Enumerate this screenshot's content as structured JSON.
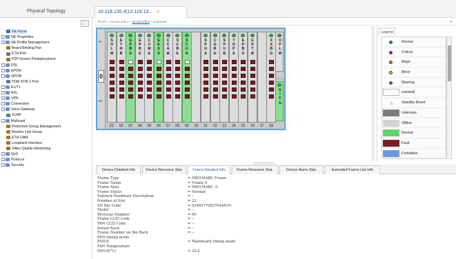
{
  "tabs": {
    "physical_topology": "Physical Topology",
    "active_tab": "10.118.135.4(10.118.13...",
    "close": "×"
  },
  "breadcrumb": {
    "root": "ROOT",
    "ip1": "10.118.135.4",
    "ip2": "10.118.135.4",
    "subrack": "Subrack0",
    "sep": ">"
  },
  "tree": [
    {
      "label": "NE Panel",
      "ctl": "",
      "icon": "ne-panel",
      "selected": true
    },
    {
      "label": "NE Properties",
      "ctl": "+",
      "icon": "folder"
    },
    {
      "label": "NE Profile Management",
      "ctl": "+",
      "icon": "folder"
    },
    {
      "label": "Board Binding Pair",
      "ctl": "",
      "icon": "gear"
    },
    {
      "label": "ETH Port",
      "ctl": "",
      "icon": "port"
    },
    {
      "label": "P2P Device Predeployment",
      "ctl": "",
      "icon": "gear"
    },
    {
      "label": "DSL",
      "ctl": "+",
      "icon": "folder"
    },
    {
      "label": "EPON",
      "ctl": "+",
      "icon": "folder"
    },
    {
      "label": "GPON",
      "ctl": "+",
      "icon": "folder"
    },
    {
      "label": "TDM STM-1 Port",
      "ctl": "",
      "icon": "port"
    },
    {
      "label": "E1/T1",
      "ctl": "+",
      "icon": "folder"
    },
    {
      "label": "ASL",
      "ctl": "+",
      "icon": "folder"
    },
    {
      "label": "VPN",
      "ctl": "+",
      "icon": "folder"
    },
    {
      "label": "Connection",
      "ctl": "+",
      "icon": "folder"
    },
    {
      "label": "Voice Gateway",
      "ctl": "+",
      "icon": "folder"
    },
    {
      "label": "VLAN",
      "ctl": "",
      "icon": "port"
    },
    {
      "label": "Multicast",
      "ctl": "+",
      "icon": "folder"
    },
    {
      "label": "Protection Group Management",
      "ctl": "",
      "icon": "gear"
    },
    {
      "label": "Monitor Link Group",
      "ctl": "",
      "icon": "gear"
    },
    {
      "label": "ETH OAM",
      "ctl": "",
      "icon": "gear"
    },
    {
      "label": "Loopback Interface",
      "ctl": "",
      "icon": "gear"
    },
    {
      "label": "Video Quality Monitoring",
      "ctl": "",
      "icon": "gear"
    },
    {
      "label": "QoS",
      "ctl": "+",
      "icon": "folder"
    },
    {
      "label": "Protocol",
      "ctl": "+",
      "icon": "folder"
    },
    {
      "label": "Security",
      "ctl": "+",
      "icon": "folder"
    }
  ],
  "frame": {
    "row_labels": {
      "top": "21",
      "mid": "0",
      "bottom": "30"
    },
    "right_labels": {
      "r1": "19",
      "r2": "20"
    },
    "slots": [
      {
        "num": "01",
        "label": "S\nH\nL\nM",
        "green": false
      },
      {
        "num": "02",
        "label": "E\nT\nH\nB",
        "green": false
      },
      {
        "num": "03",
        "label": "G\nP\nB\nD",
        "green": true
      },
      {
        "num": "04",
        "label": "E\nP\nB\nE",
        "green": false
      },
      {
        "num": "05",
        "label": "C\nV\nM\nE",
        "green": false
      },
      {
        "num": "06",
        "label": "G\nE\nS\nD",
        "green": true
      },
      {
        "num": "07",
        "label": "C\nC\nA\nM",
        "green": false
      },
      {
        "num": "08",
        "label": "S\nC\nB\nE",
        "green": false
      },
      {
        "num": "09",
        "label": "S\nC\nU\nN",
        "green": true
      },
      {
        "num": "10",
        "label": "",
        "green": false
      },
      {
        "num": "11",
        "label": "S\nP\nU\nA",
        "green": false
      },
      {
        "num": "12",
        "label": "C\nG\nB\nE",
        "green": false
      },
      {
        "num": "13",
        "label": "S\nP\nU\nB",
        "green": false
      },
      {
        "num": "14",
        "label": "T\nO\nP\nA",
        "green": false
      },
      {
        "num": "15",
        "label": "E\nP\nB\nD",
        "green": false
      },
      {
        "num": "16",
        "label": "E\nP\nT\nB",
        "green": false
      },
      {
        "num": "17",
        "label": "",
        "green": false
      },
      {
        "num": "18",
        "label": "X\nS\nB\nD",
        "green": false
      },
      {
        "num": "19",
        "label": "O\nP\nL\nM",
        "green": false
      },
      {
        "num": "20",
        "label": "G\nI\nC\nG",
        "green": true
      }
    ]
  },
  "legend": {
    "tab": "Legend",
    "items": [
      {
        "label": "Normal",
        "color": "#3fae4a",
        "kind": "dot"
      },
      {
        "label": "Critical",
        "color": "#d82a2a",
        "kind": "dot"
      },
      {
        "label": "Major",
        "color": "#ee7b22",
        "kind": "dot"
      },
      {
        "label": "Minor",
        "color": "#e3bb2a",
        "kind": "dot"
      },
      {
        "label": "Warning",
        "color": "#3d86d6",
        "kind": "dot"
      },
      {
        "label": "uninstall",
        "color": "#ffffff",
        "kind": "box"
      },
      {
        "label": "Standby Board",
        "color": "#ffffff",
        "kind": "text",
        "mark": "S"
      },
      {
        "label": "Unknown",
        "color": "#7c7c7c",
        "kind": "box"
      },
      {
        "label": "Offline",
        "color": "#d4d4d4",
        "kind": "box"
      },
      {
        "label": "Normal",
        "color": "#62d36b",
        "kind": "box"
      },
      {
        "label": "Fault",
        "color": "#7a1f27",
        "kind": "box"
      },
      {
        "label": "Forbidden",
        "color": "#6b9ae0",
        "kind": "box"
      }
    ]
  },
  "bottom_tabs": [
    {
      "label": "Device Detailed Info",
      "active": false
    },
    {
      "label": "Device Resource Stat.",
      "active": false
    },
    {
      "label": "Frame Detailed Info",
      "active": true
    },
    {
      "label": "Frame Resource Stat.",
      "active": false
    },
    {
      "label": "Device Alarm Stat.",
      "active": false
    },
    {
      "label": "Extended Frame List Info",
      "active": false
    }
  ],
  "details": [
    {
      "k": "Frame Type",
      "v": "= H801MABC Frame"
    },
    {
      "k": "Frame Name",
      "v": "= Frame 0"
    },
    {
      "k": "Frame Alias",
      "v": "= H801MABC_0"
    },
    {
      "k": "Frame Status",
      "v": "= Normal"
    },
    {
      "k": "Subrack Hardware Description",
      "v": "= --"
    },
    {
      "k": "Number of Slot",
      "v": "= 23"
    },
    {
      "k": "SN Bar Code",
      "v": "= 0299377082704461O"
    },
    {
      "k": "Model",
      "v": "= --"
    },
    {
      "k": "Revissue Number",
      "v": "= 00"
    },
    {
      "k": "Frame CLEI Code",
      "v": "= --"
    },
    {
      "k": "FAN CLEI Code",
      "v": "= --"
    },
    {
      "k": "Parent Rack",
      "v": "= --"
    },
    {
      "k": "Frame Number on the Rack",
      "v": "= --"
    },
    {
      "k": "FAN timing mode",
      "v": ""
    },
    {
      "k": "EMU0",
      "v": "= Mainboard timing mode"
    },
    {
      "k": "FAN Temperature",
      "v": ""
    },
    {
      "k": "EMU0(°C)",
      "v": "= 32.0"
    }
  ]
}
